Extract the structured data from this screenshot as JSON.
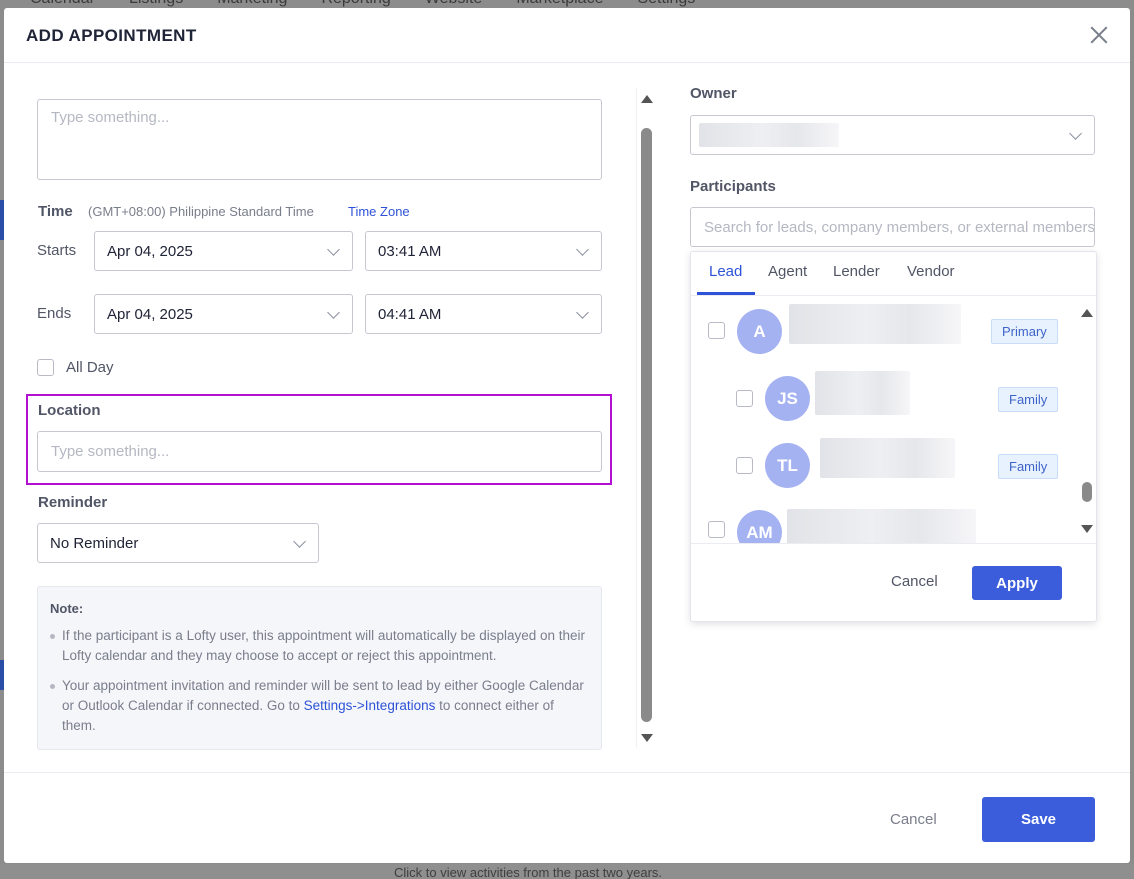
{
  "background": {
    "nav_items": [
      "Calendar",
      "Listings",
      "Marketing",
      "Reporting",
      "Website",
      "Marketplace",
      "Settings"
    ],
    "footer_text": "Click to view activities from the past two years."
  },
  "modal": {
    "title": "ADD APPOINTMENT",
    "description_placeholder": "Type something...",
    "time": {
      "label": "Time",
      "timezone": "(GMT+08:00) Philippine Standard Time",
      "timezone_link": "Time Zone",
      "starts_label": "Starts",
      "starts_date": "Apr 04, 2025",
      "starts_time": "03:41 AM",
      "ends_label": "Ends",
      "ends_date": "Apr 04, 2025",
      "ends_time": "04:41 AM",
      "all_day_label": "All Day"
    },
    "location": {
      "label": "Location",
      "placeholder": "Type something..."
    },
    "reminder": {
      "label": "Reminder",
      "value": "No Reminder"
    },
    "note": {
      "title": "Note:",
      "item1": "If the participant is a Lofty user, this appointment will automatically be displayed on their Lofty calendar and they may choose to accept or reject this appointment.",
      "item2_pre": "Your appointment invitation and reminder will be sent to lead by either Google Calendar or Outlook Calendar if connected. Go to ",
      "item2_link": "Settings->Integrations",
      "item2_post": " to connect either of them."
    },
    "owner": {
      "label": "Owner"
    },
    "participants": {
      "label": "Participants",
      "search_placeholder": "Search for leads, company members, or external members",
      "tabs": [
        "Lead",
        "Agent",
        "Lender",
        "Vendor"
      ],
      "active_tab": "Lead",
      "list": [
        {
          "initials": "A",
          "tag": "Primary"
        },
        {
          "initials": "JS",
          "tag": "Family"
        },
        {
          "initials": "TL",
          "tag": "Family"
        },
        {
          "initials": "AM",
          "tag": ""
        }
      ],
      "cancel_label": "Cancel",
      "apply_label": "Apply"
    },
    "footer": {
      "cancel_label": "Cancel",
      "save_label": "Save"
    }
  },
  "colors": {
    "accent": "#3b5ddc",
    "link": "#2d52d7",
    "highlight": "#b30fd1",
    "avatar": "#a5b2f2"
  }
}
